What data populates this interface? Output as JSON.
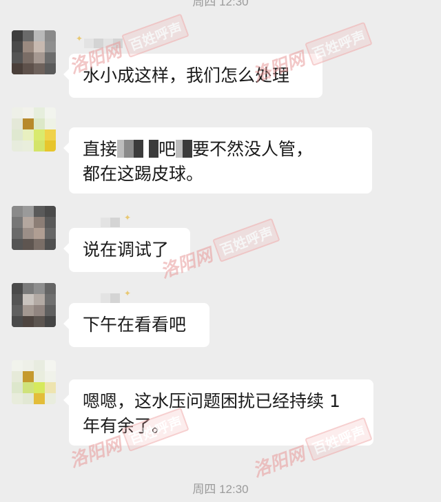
{
  "chat": {
    "timestamp_top": "周四 12:30",
    "timestamp_bottom": "周四 12:30",
    "messages": [
      {
        "text": "水小成这样，我们怎么处理"
      },
      {
        "text_line1_start": "直接",
        "text_line1_mid": "吧",
        "text_line1_end": "要不然没人管，",
        "text_line2": "都在这踢皮球。"
      },
      {
        "text": "说在调试了"
      },
      {
        "text": "下午在看看吧"
      },
      {
        "text_line1": "嗯嗯，这水压问题困扰已经持续 1",
        "text_line2": "年有余了。"
      }
    ]
  },
  "watermark": {
    "brand": "洛阳网",
    "box": "百姓呼声"
  },
  "colors": {
    "background": "#ededed",
    "bubble": "#ffffff",
    "timestamp": "#9b9b9b",
    "watermark": "#e89a9a"
  }
}
